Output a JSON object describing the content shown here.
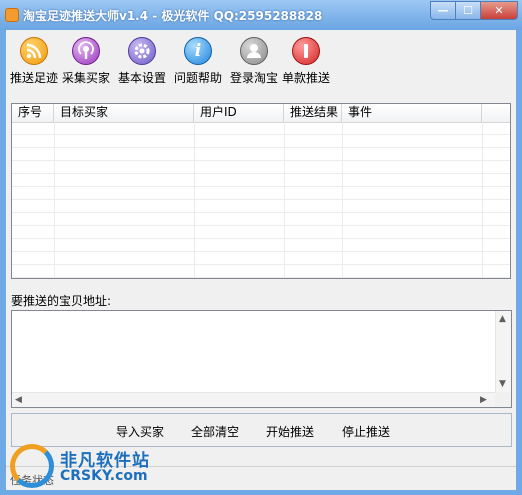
{
  "window": {
    "title": "淘宝足迹推送大师v1.4 - 极光软件 QQ:2595288828",
    "minimize_glyph": "—",
    "maximize_glyph": "☐",
    "close_glyph": "✕"
  },
  "toolbar": {
    "items": [
      {
        "label": "推送足迹",
        "icon": "rss-icon"
      },
      {
        "label": "采集买家",
        "icon": "podcast-icon"
      },
      {
        "label": "基本设置",
        "icon": "gear-icon"
      },
      {
        "label": "问题帮助",
        "icon": "info-icon"
      },
      {
        "label": "登录淘宝",
        "icon": "user-icon"
      },
      {
        "label": "单款推送",
        "icon": "stop-icon"
      }
    ]
  },
  "table": {
    "columns": [
      "序号",
      "目标买家",
      "用户ID",
      "推送结果",
      "事件"
    ]
  },
  "address": {
    "label": "要推送的宝贝地址:",
    "value": ""
  },
  "buttons": {
    "import": "导入买家",
    "clear": "全部清空",
    "start": "开始推送",
    "stop": "停止推送"
  },
  "status": {
    "text": "任务状态"
  },
  "watermark": {
    "cn": "非凡软件站",
    "en": "CRSKY.com"
  },
  "colors": {
    "titlebar": "#6aa5e3",
    "client": "#f0f0f0"
  }
}
